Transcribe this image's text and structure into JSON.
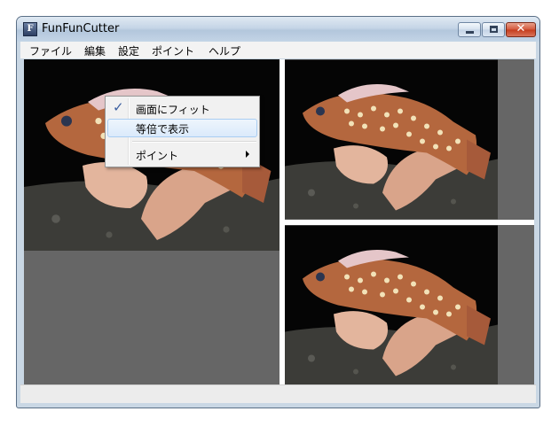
{
  "window": {
    "title": "FunFunCutter",
    "icon_glyph": "F"
  },
  "title_buttons": {
    "close_glyph": "✕"
  },
  "menubar": {
    "items": [
      "ファイル",
      "編集",
      "設定",
      "ポイント",
      "ヘルプ"
    ]
  },
  "context_menu": {
    "items": [
      {
        "label": "画面にフィット",
        "checked": true
      },
      {
        "label": "等倍で表示",
        "highlighted": true
      },
      {
        "label": "ポイント",
        "submenu": true
      }
    ],
    "check_glyph": "✓"
  },
  "status_bar": {
    "text": ""
  }
}
